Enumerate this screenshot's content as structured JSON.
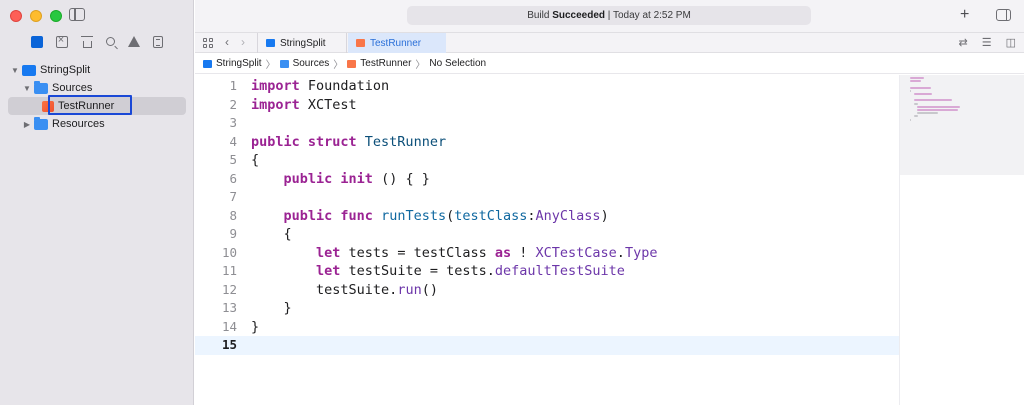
{
  "window": {
    "build_status_prefix": "Build ",
    "build_status_bold": "Succeeded",
    "build_status_time": " | Today at 2:52 PM",
    "add_label": "+"
  },
  "navigator": {
    "project": "StringSplit",
    "sources": "Sources",
    "file": "TestRunner",
    "resources": "Resources",
    "icons": [
      "folder-icon",
      "source-control-icon",
      "hierarchy-icon",
      "search-icon",
      "warning-icon",
      "test-icon"
    ]
  },
  "tabs": [
    {
      "label": "StringSplit",
      "active": false
    },
    {
      "label": "TestRunner",
      "active": true
    }
  ],
  "breadcrumb": [
    "StringSplit",
    "Sources",
    "TestRunner",
    "No Selection"
  ],
  "editor": {
    "current_line": 15,
    "lines": [
      {
        "n": "1",
        "tokens": [
          [
            "kw",
            "import"
          ],
          [
            "",
            "Foundation"
          ]
        ]
      },
      {
        "n": "2",
        "tokens": [
          [
            "kw",
            "import"
          ],
          [
            "",
            "XCTest"
          ]
        ]
      },
      {
        "n": "3",
        "tokens": []
      },
      {
        "n": "4",
        "tokens": [
          [
            "kw",
            "public struct"
          ],
          [
            "ty",
            "TestRunner"
          ]
        ]
      },
      {
        "n": "5",
        "tokens": [
          [
            "",
            "{"
          ]
        ]
      },
      {
        "n": "6",
        "tokens": [
          [
            "",
            "    "
          ],
          [
            "kw",
            "public"
          ],
          [
            "",
            ""
          ],
          [
            "kw",
            "init"
          ],
          [
            "",
            "() { }"
          ]
        ]
      },
      {
        "n": "7",
        "tokens": []
      },
      {
        "n": "8",
        "tokens": [
          [
            "",
            "    "
          ],
          [
            "kw",
            "public func"
          ],
          [
            "",
            ""
          ],
          [
            "fn",
            "runTests"
          ],
          [
            "",
            "("
          ],
          [
            "fn",
            "testClass"
          ],
          [
            "",
            ":"
          ],
          [
            "sy",
            "AnyClass"
          ],
          [
            "",
            ")"
          ]
        ]
      },
      {
        "n": "9",
        "tokens": [
          [
            "",
            "    {"
          ]
        ]
      },
      {
        "n": "10",
        "tokens": [
          [
            "",
            "        "
          ],
          [
            "kw",
            "let"
          ],
          [
            "",
            "tests = testClass "
          ],
          [
            "kw",
            "as"
          ],
          [
            "",
            "! "
          ],
          [
            "sy",
            "XCTestCase"
          ],
          [
            "",
            "."
          ],
          [
            "sy",
            "Type"
          ]
        ]
      },
      {
        "n": "11",
        "tokens": [
          [
            "",
            "        "
          ],
          [
            "kw",
            "let"
          ],
          [
            "",
            "testSuite = tests."
          ],
          [
            "sy",
            "defaultTestSuite"
          ]
        ]
      },
      {
        "n": "12",
        "tokens": [
          [
            "",
            "        testSuite."
          ],
          [
            "sy",
            "run"
          ],
          [
            "",
            "()"
          ]
        ]
      },
      {
        "n": "13",
        "tokens": [
          [
            "",
            "    }"
          ]
        ]
      },
      {
        "n": "14",
        "tokens": [
          [
            "",
            "}"
          ]
        ]
      },
      {
        "n": "15",
        "tokens": []
      }
    ]
  },
  "colors": {
    "keyword": "#9b2393",
    "type_decl": "#0b4f79",
    "function": "#0f68a0",
    "system_type": "#6c36a9",
    "current_line": "#ecf5ff",
    "selection_outline": "#1a48d6"
  }
}
